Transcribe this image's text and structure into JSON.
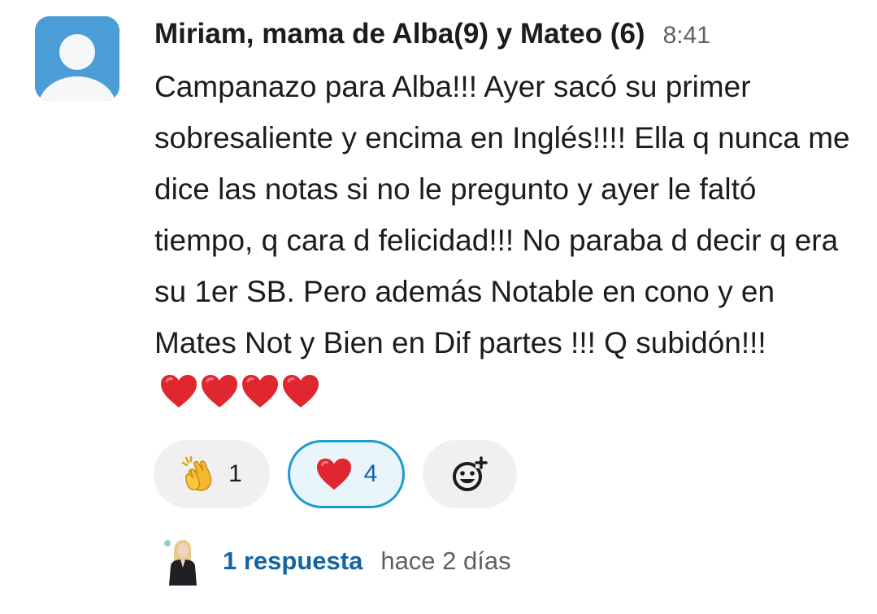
{
  "message": {
    "sender": "Miriam, mama de Alba(9) y Mateo (6)",
    "time": "8:41",
    "text": "Campanazo para Alba!!! Ayer sacó su primer sobresaliente y encima en Inglés!!!! Ella q nunca me dice las notas si no le pregunto y ayer le faltó tiempo, q cara d felicidad!!! No paraba d decir q era su 1er SB. Pero además Notable en cono y en Mates Not y Bien en Dif partes !!! Q subidón!!!",
    "trailing_emoji": [
      "red-heart",
      "red-heart",
      "red-heart",
      "red-heart"
    ],
    "avatar_icon": "default-user-avatar",
    "avatar_color": "#4a9dd6"
  },
  "reactions": [
    {
      "emoji": "clapping-hands",
      "count": "1",
      "selected": false
    },
    {
      "emoji": "red-heart",
      "count": "4",
      "selected": true
    },
    {
      "emoji": "add-reaction",
      "count": "",
      "selected": false
    }
  ],
  "thread": {
    "reply_count": "1 respuesta",
    "last_reply": "hace 2 días",
    "replier_avatar": "user-photo"
  },
  "colors": {
    "link": "#1264a3",
    "selected_border": "#1d9bd1",
    "selected_bg": "#e8f5fa",
    "pill_bg": "#f0f0f0",
    "heart": "#e0262f"
  }
}
